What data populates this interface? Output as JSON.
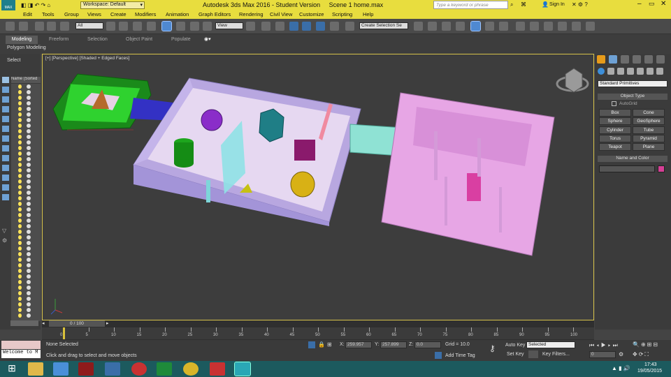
{
  "window": {
    "app_logo": "MAX",
    "workspace": "Workspace: Default",
    "title": "Autodesk 3ds Max 2016 - Student Version",
    "file": "Scene 1 home.max",
    "search_placeholder": "Type a keyword or phrase",
    "sign_in": "Sign In"
  },
  "menu": [
    "Edit",
    "Tools",
    "Group",
    "Views",
    "Create",
    "Modifiers",
    "Animation",
    "Graph Editors",
    "Rendering",
    "Civil View",
    "Customize",
    "Scripting",
    "Help"
  ],
  "toolbar": {
    "selection_filter": "All",
    "coord_system": "View",
    "named_selection": "Create Selection Se"
  },
  "ribbon": {
    "tabs": [
      "Modeling",
      "Freeform",
      "Selection",
      "Object Paint",
      "Populate"
    ],
    "active_tab": "Modeling",
    "sub_label": "Polygon Modeling"
  },
  "scene_explorer": {
    "select_label": "Select",
    "column_header": "Name (Sorted"
  },
  "viewport": {
    "label": "[+] [Perspective] [Shaded + Edged Faces]"
  },
  "command_panel": {
    "category": "Standard Primitives",
    "rollout_object_type": "Object Type",
    "autogrid": "AutoGrid",
    "buttons": [
      "Box",
      "Cone",
      "Sphere",
      "GeoSphere",
      "Cylinder",
      "Tube",
      "Torus",
      "Pyramid",
      "Teapot",
      "Plane"
    ],
    "rollout_name_color": "Name and Color",
    "object_color": "#d63f95"
  },
  "timeline": {
    "frame_counter": "0 / 100",
    "ticks": [
      "0",
      "5",
      "10",
      "15",
      "20",
      "25",
      "30",
      "35",
      "40",
      "45",
      "50",
      "55",
      "60",
      "65",
      "70",
      "75",
      "80",
      "85",
      "90",
      "95",
      "100"
    ]
  },
  "status": {
    "maxscript_text": "Welcome to M",
    "selection_status": "None Selected",
    "prompt": "Click and drag to select and move objects",
    "x_label": "X:",
    "x_value": "259.957",
    "y_label": "Y:",
    "y_value": "257.899",
    "z_label": "Z:",
    "z_value": "0.0",
    "grid": "Grid = 10.0",
    "add_time_tag": "Add Time Tag",
    "auto_key": "Auto Key",
    "key_mode": "Selected",
    "set_key": "Set Key",
    "key_filters": "Key Filters...",
    "current_frame": "0"
  },
  "taskbar": {
    "time": "17:43",
    "date": "19/05/2015"
  }
}
